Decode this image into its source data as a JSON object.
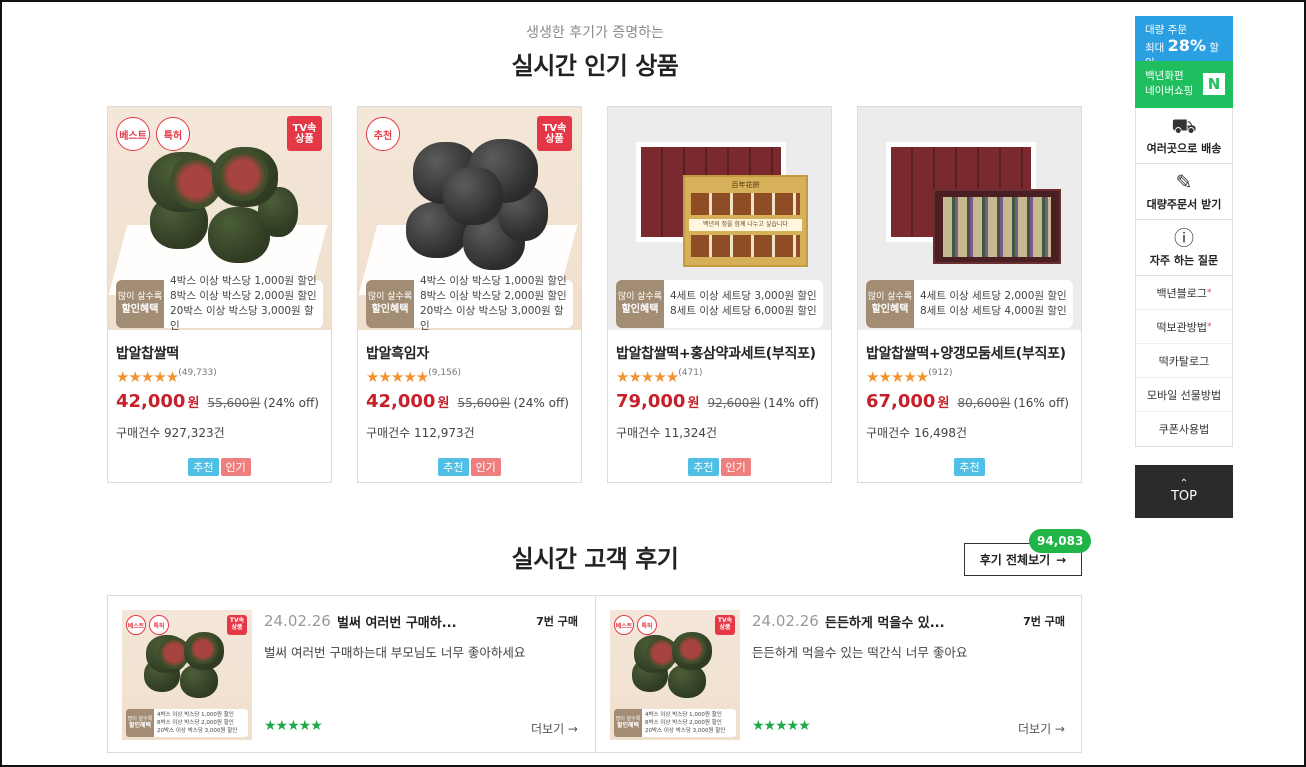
{
  "section": {
    "subtitle": "생생한 후기가 증명하는",
    "title": "실시간 인기 상품"
  },
  "products": [
    {
      "name": "밥알찹쌀떡",
      "badges": [
        "베스트",
        "특허"
      ],
      "tv_badge": "TV속 상품",
      "promo_tag_top": "많이 살수록",
      "promo_tag_bottom": "할인혜택",
      "promo_lines": [
        "4박스 이상 박스당 1,000원 할인",
        "8박스 이상 박스당 2,000원 할인",
        "20박스 이상 박스당 3,000원 할인"
      ],
      "rating_count": "(49,733)",
      "price": "42,000",
      "won": "원",
      "original_price": "55,600원",
      "discount": "(24% off)",
      "sold": "구매건수 927,323건",
      "tags": [
        "추천",
        "인기"
      ],
      "image": "green-rice-cake"
    },
    {
      "name": "밥알흑임자",
      "badges": [
        "추천"
      ],
      "tv_badge": "TV속 상품",
      "promo_tag_top": "많이 살수록",
      "promo_tag_bottom": "할인혜택",
      "promo_lines": [
        "4박스 이상 박스당 1,000원 할인",
        "8박스 이상 박스당 2,000원 할인",
        "20박스 이상 박스당 3,000원 할인"
      ],
      "rating_count": "(9,156)",
      "price": "42,000",
      "won": "원",
      "original_price": "55,600원",
      "discount": "(24% off)",
      "sold": "구매건수 112,973건",
      "tags": [
        "추천",
        "인기"
      ],
      "image": "black-sesame-rice-cake"
    },
    {
      "name": "밥알찹쌀떡+홍삼약과세트(부직포)",
      "badges": [],
      "tv_badge": "",
      "promo_tag_top": "많이 살수록",
      "promo_tag_bottom": "할인혜택",
      "promo_lines": [
        "4세트 이상 세트당 3,000원 할인",
        "8세트 이상 세트당 6,000원 할인"
      ],
      "rating_count": "(471)",
      "price": "79,000",
      "won": "원",
      "original_price": "92,600원",
      "discount": "(14% off)",
      "sold": "구매건수 11,324건",
      "tags": [
        "추천",
        "인기"
      ],
      "image": "gift-set-yakgwa",
      "gift_box_text": "백년의 정을 함께 나누고 싶습니다"
    },
    {
      "name": "밥알찹쌀떡+양갱모둠세트(부직포)",
      "badges": [],
      "tv_badge": "",
      "promo_tag_top": "많이 살수록",
      "promo_tag_bottom": "할인혜택",
      "promo_lines": [
        "4세트 이상 세트당 2,000원 할인",
        "8세트 이상 세트당 4,000원 할인"
      ],
      "rating_count": "(912)",
      "price": "67,000",
      "won": "원",
      "original_price": "80,600원",
      "discount": "(16% off)",
      "sold": "구매건수 16,498건",
      "tags": [
        "추천"
      ],
      "image": "gift-set-yanggaeng"
    }
  ],
  "stars": "★★★★★",
  "reviews_section": {
    "title": "실시간 고객 후기",
    "all_button": "후기 전체보기",
    "arrow": "→",
    "count": "94,083"
  },
  "reviews": [
    {
      "date": "24.02.26",
      "headline": "벌써 여러번 구매하...",
      "times": "7번 구매",
      "body": "벌써 여러번 구매하는대 부모님도 너무 좋아하세요",
      "more": "더보기 →"
    },
    {
      "date": "24.02.26",
      "headline": "든든하게 먹을수 있...",
      "times": "7번 구매",
      "body": "든든하게 먹을수 있는 떡간식 너무 좋아요",
      "more": "더보기 →"
    }
  ],
  "sidebar": {
    "bulk_line1": "대량 주문",
    "bulk_line2_prefix": "최대",
    "bulk_pct": "28%",
    "bulk_line2_suffix": "할인",
    "naver_line1": "백년화편",
    "naver_line2": "네이버쇼핑",
    "naver_logo": "N",
    "icon_items": [
      {
        "label": "여러곳으로 배송",
        "icon": "truck-icon"
      },
      {
        "label": "대량주문서 받기",
        "icon": "document-icon"
      },
      {
        "label": "자주 하는 질문",
        "icon": "question-icon"
      }
    ],
    "links": [
      "백년블로그",
      "떡보관방법",
      "떡카탈로그",
      "모바일 선물방법",
      "쿠폰사용법"
    ],
    "top": "TOP"
  },
  "colors": {
    "price_red": "#c7202b",
    "star_orange": "#f09431",
    "review_green": "#21a84a",
    "bulk_blue": "#2a9fe2",
    "naver_green": "#1fbf5f",
    "tag_recommend": "#4fbfe5",
    "tag_popular": "#ef7e7e"
  }
}
